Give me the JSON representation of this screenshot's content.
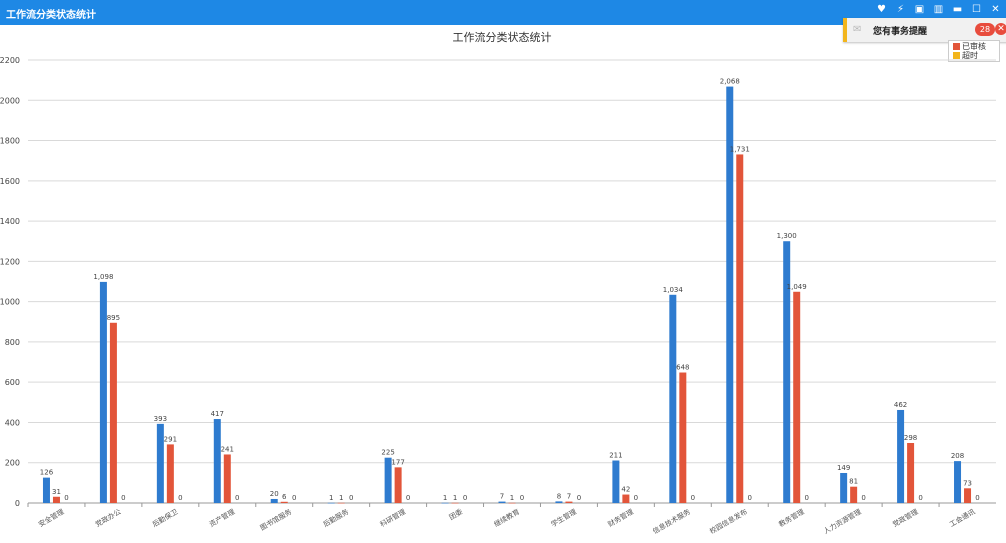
{
  "window": {
    "title": "工作流分类状态统计",
    "buttons": [
      "heart-icon",
      "pin-icon",
      "square-icon",
      "book-icon",
      "minimize-icon",
      "maximize-icon",
      "close-icon"
    ]
  },
  "notification": {
    "text": "您有事务提醒",
    "count": "28"
  },
  "legend": {
    "items": [
      {
        "label": "已审核",
        "color": "#e2553a"
      },
      {
        "label": "超时",
        "color": "#f2b51c"
      }
    ]
  },
  "chart_data": {
    "type": "bar",
    "title": "工作流分类状态统计",
    "ylim": [
      0,
      2200
    ],
    "yticks": [
      0,
      200,
      400,
      600,
      800,
      1000,
      1200,
      1400,
      1600,
      1800,
      2000,
      2200
    ],
    "grid": true,
    "categories": [
      "安全管理",
      "党政办公",
      "后勤保卫",
      "资产管理",
      "图书馆服务",
      "后勤服务",
      "科研管理",
      "团委",
      "继续教育",
      "学生管理",
      "财务管理",
      "信息技术服务",
      "校园信息发布",
      "教务管理",
      "人力资源管理",
      "党政管理",
      "工会通讯"
    ],
    "series": [
      {
        "color": "#2e7bcf",
        "values": [
          126,
          1098,
          393,
          417,
          20,
          1,
          225,
          1,
          7,
          8,
          211,
          1034,
          2068,
          1300,
          149,
          462,
          208
        ]
      },
      {
        "color": "#e2553a",
        "values": [
          31,
          895,
          291,
          241,
          6,
          1,
          177,
          1,
          1,
          7,
          42,
          648,
          1731,
          1049,
          81,
          298,
          73
        ]
      },
      {
        "color": "#f2b51c",
        "values": [
          0,
          0,
          0,
          0,
          0,
          0,
          0,
          0,
          0,
          0,
          0,
          0,
          0,
          0,
          0,
          0,
          0
        ]
      }
    ],
    "bar_labels": [
      [
        "126",
        "1,098",
        "393",
        "417",
        "20",
        "1",
        "225",
        "1",
        "7",
        "8",
        "211",
        "1,034",
        "2,068",
        "1,300",
        "149",
        "462",
        "208"
      ],
      [
        "31",
        "895",
        "291",
        "241",
        "6",
        "1",
        "177",
        "1",
        "1",
        "7",
        "42",
        "648",
        "1,731",
        "1,049",
        "81",
        "298",
        "73"
      ],
      [
        "0",
        "0",
        "0",
        "0",
        "0",
        "0",
        "0",
        "0",
        "0",
        "0",
        "0",
        "0",
        "0",
        "0",
        "0",
        "0",
        "0"
      ]
    ]
  }
}
